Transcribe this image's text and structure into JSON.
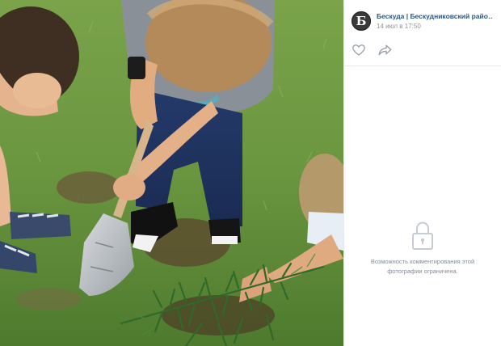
{
  "post": {
    "author": "Бескуда | Бескудниковский район ...",
    "avatar_letter": "Б",
    "date": "14 июл в 17:50"
  },
  "actions": {
    "like_icon": "heart-icon",
    "share_icon": "share-arrow-icon"
  },
  "comments": {
    "lock_icon": "lock-icon",
    "restricted_text": "Возможность комментирования этой фотографии ограничена."
  },
  "colors": {
    "link": "#2a5885",
    "muted": "#939393",
    "icon": "#99a2ad",
    "divider": "#e7e8ec"
  }
}
